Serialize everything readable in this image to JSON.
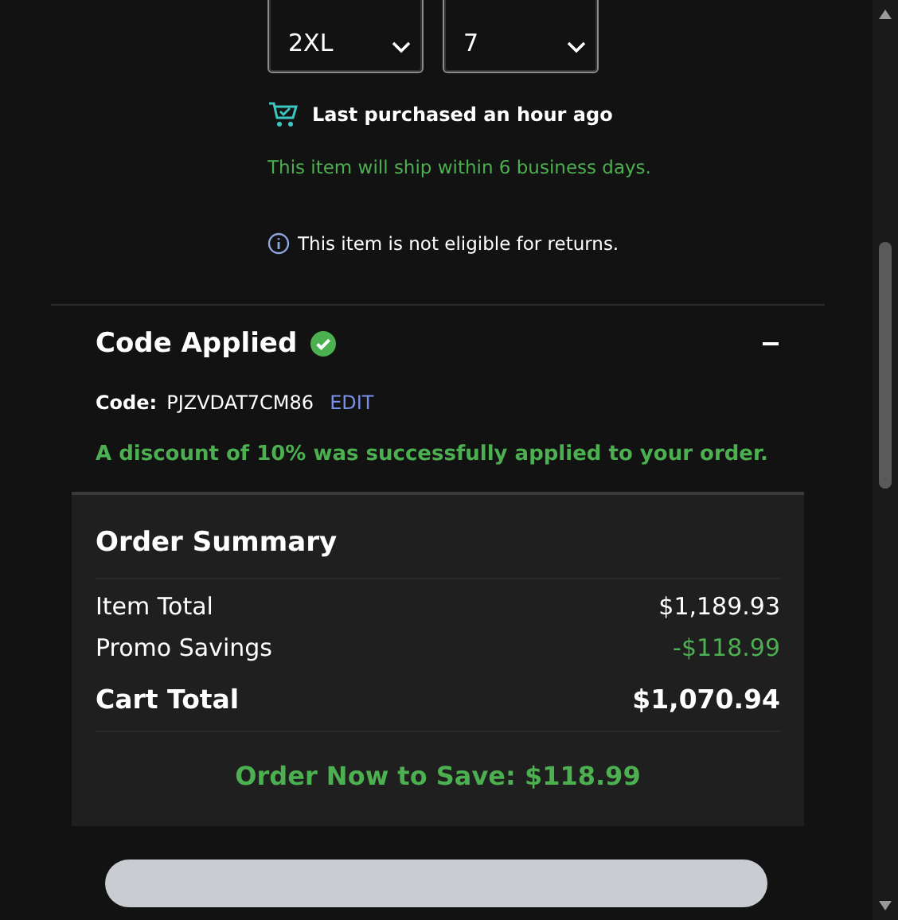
{
  "selects": [
    {
      "value": "2XL"
    },
    {
      "value": "7"
    }
  ],
  "last_purchased": "Last purchased an hour ago",
  "shipping_note": "This item will ship within 6 business days.",
  "returns_note": "This item is not eligible for returns.",
  "promo": {
    "title": "Code Applied",
    "applied": true,
    "expanded": true,
    "code_label": "Code:",
    "code": "PJZVDAT7CM86",
    "edit": "EDIT",
    "message": "A discount of 10% was successfully applied to your order."
  },
  "order_summary": {
    "title": "Order Summary",
    "rows": [
      {
        "kind": "normal",
        "label": "Item Total",
        "value": "$1,189.93"
      },
      {
        "kind": "savings",
        "label": "Promo Savings",
        "value": "-$118.99"
      },
      {
        "kind": "total",
        "label": "Cart Total",
        "value": "$1,070.94"
      }
    ],
    "savings_banner": "Order Now to Save: $118.99"
  }
}
